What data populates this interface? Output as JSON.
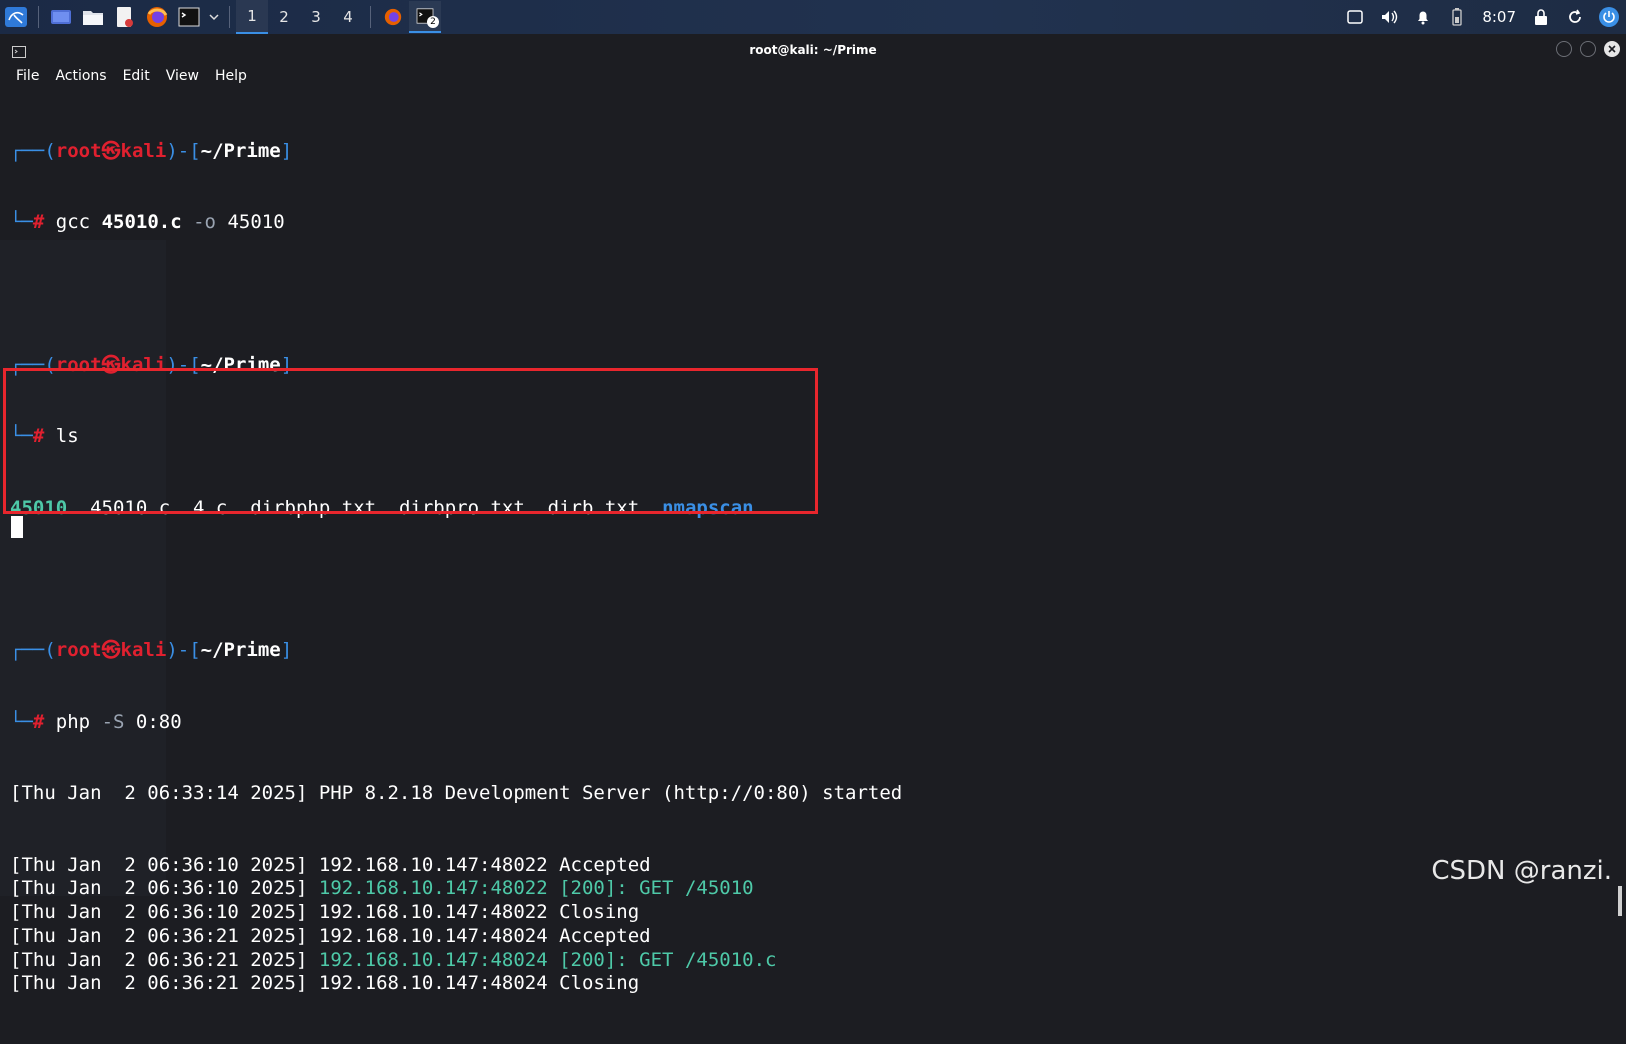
{
  "taskbar": {
    "workspaces": [
      "1",
      "2",
      "3",
      "4"
    ],
    "active_workspace": "1",
    "terminal_badge": "2",
    "clock": "8:07",
    "icons": [
      "kali-menu-icon",
      "desktop-icon",
      "file-manager-icon",
      "text-editor-icon",
      "firefox-icon",
      "terminal-icon",
      "chevron-down-icon",
      "firefox-task-icon",
      "terminal-task-icon",
      "screen-icon",
      "volume-icon",
      "bell-icon",
      "battery-icon",
      "lock-icon",
      "refresh-icon",
      "power-icon"
    ]
  },
  "window": {
    "title": "root@kali: ~/Prime",
    "menu": [
      "File",
      "Actions",
      "Edit",
      "View",
      "Help"
    ]
  },
  "terminal": {
    "prompt": {
      "user": "root",
      "skull": "㉿",
      "host": "kali",
      "path": "~/Prime",
      "hash": "#"
    },
    "cmd1": {
      "bin": "gcc",
      "file": "45010.c",
      "opt": "-o",
      "out": "45010"
    },
    "cmd2": {
      "bin": "ls"
    },
    "ls_output": {
      "exe": "45010",
      "files": "45010.c  4.c  dirbphp.txt  dirbpro.txt  dirb.txt",
      "dir": "nmapscan"
    },
    "cmd3": {
      "bin": "php",
      "opt": "-S",
      "arg": "0:80"
    },
    "server_started": "[Thu Jan  2 06:33:14 2025] PHP 8.2.18 Development Server (http://0:80) started",
    "log": [
      {
        "ts": "[Thu Jan  2 06:36:10 2025]",
        "addr": "192.168.10.147:48022",
        "msg": "Accepted",
        "colored": false
      },
      {
        "ts": "[Thu Jan  2 06:36:10 2025]",
        "addr": "192.168.10.147:48022",
        "msg": "[200]: GET /45010",
        "colored": true
      },
      {
        "ts": "[Thu Jan  2 06:36:10 2025]",
        "addr": "192.168.10.147:48022",
        "msg": "Closing",
        "colored": false
      },
      {
        "ts": "[Thu Jan  2 06:36:21 2025]",
        "addr": "192.168.10.147:48024",
        "msg": "Accepted",
        "colored": false
      },
      {
        "ts": "[Thu Jan  2 06:36:21 2025]",
        "addr": "192.168.10.147:48024",
        "msg": "[200]: GET /45010.c",
        "colored": true
      },
      {
        "ts": "[Thu Jan  2 06:36:21 2025]",
        "addr": "192.168.10.147:48024",
        "msg": "Closing",
        "colored": false
      }
    ]
  },
  "watermark": "CSDN @ranzi.",
  "colors": {
    "accent": "#3a8fe5",
    "prompt_red": "#e0202f",
    "teal": "#4ec9a8",
    "highlight": "#e8262d",
    "background": "#1c1d22"
  }
}
